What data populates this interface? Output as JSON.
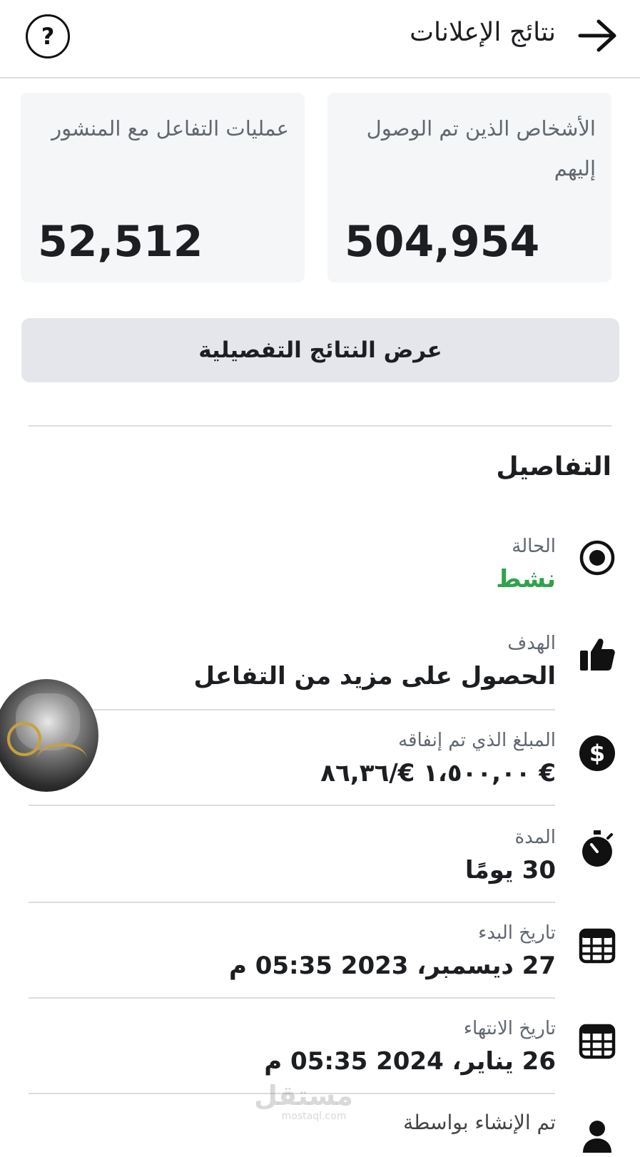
{
  "header": {
    "title": "نتائج الإعلانات",
    "back_icon": "arrow-right-icon",
    "help_label": "?"
  },
  "stats": {
    "reach_label": "الأشخاص الذين تم الوصول إليهم",
    "reach_value": "504,954",
    "engagement_label": "عمليات  التفاعل مع المنشور",
    "engagement_value": "52,512"
  },
  "detail_button_label": "عرض النتائج التفصيلية",
  "details": {
    "title": "التفاصيل",
    "rows": [
      {
        "icon": "radio-target-icon",
        "label": "الحالة",
        "value": "نشط"
      },
      {
        "icon": "thumbs-up-icon",
        "label": "الهدف",
        "value": "الحصول على مزيد من التفاعل"
      },
      {
        "icon": "dollar-icon",
        "label": "المبلغ الذي تم إنفاقه",
        "value": "€ ١،٥٠٠,٠٠ €/٨٦,٣٦"
      },
      {
        "icon": "stopwatch-icon",
        "label": "المدة",
        "value": "30 يومًا"
      },
      {
        "icon": "calendar-icon",
        "label": "تاريخ البدء",
        "value": "27 ديسمبر، 2023 05:35 م"
      },
      {
        "icon": "calendar-icon",
        "label": "تاريخ الانتهاء",
        "value": "26 يناير، 2024 05:35 م"
      },
      {
        "icon": "person-icon",
        "label": "تم الإنشاء بواسطة"
      }
    ]
  },
  "colors": {
    "active_status": "#31a24c",
    "card_background": "#f5f6f7",
    "button_background": "#e4e6eb"
  },
  "watermark": {
    "arabic": "مستقل",
    "latin": "mostaql.com"
  }
}
